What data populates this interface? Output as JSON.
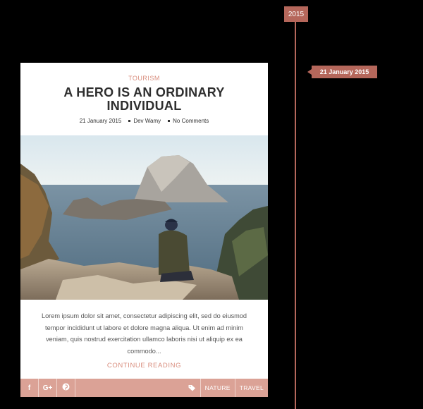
{
  "timeline": {
    "year": "2015",
    "date": "21 January 2015"
  },
  "post": {
    "category": "TOURISM",
    "title": "A HERO IS AN ORDINARY INDIVIDUAL",
    "meta": {
      "date": "21 January 2015",
      "author": "Dev Wamy",
      "comments": "No Comments"
    },
    "image_alt": "Man sitting on rocks overlooking the sea and a rocky island",
    "excerpt": "Lorem ipsum dolor sit amet, consectetur adipiscing elit, sed do eiusmod tempor incididunt ut labore et dolore magna aliqua. Ut enim ad minim veniam, quis nostrud exercitation ullamco laboris nisi ut aliquip ex ea commodo...",
    "continue_label": "CONTINUE READING",
    "share": {
      "facebook": "f",
      "google": "G+",
      "pinterest": "P"
    },
    "tags": [
      "NATURE",
      "TRAVEL"
    ]
  },
  "colors": {
    "accent": "#b5675b",
    "accent_light": "#dba296",
    "category": "#d98e7e"
  },
  "icons": [
    "facebook-icon",
    "google-plus-icon",
    "pinterest-icon",
    "tag-icon"
  ]
}
